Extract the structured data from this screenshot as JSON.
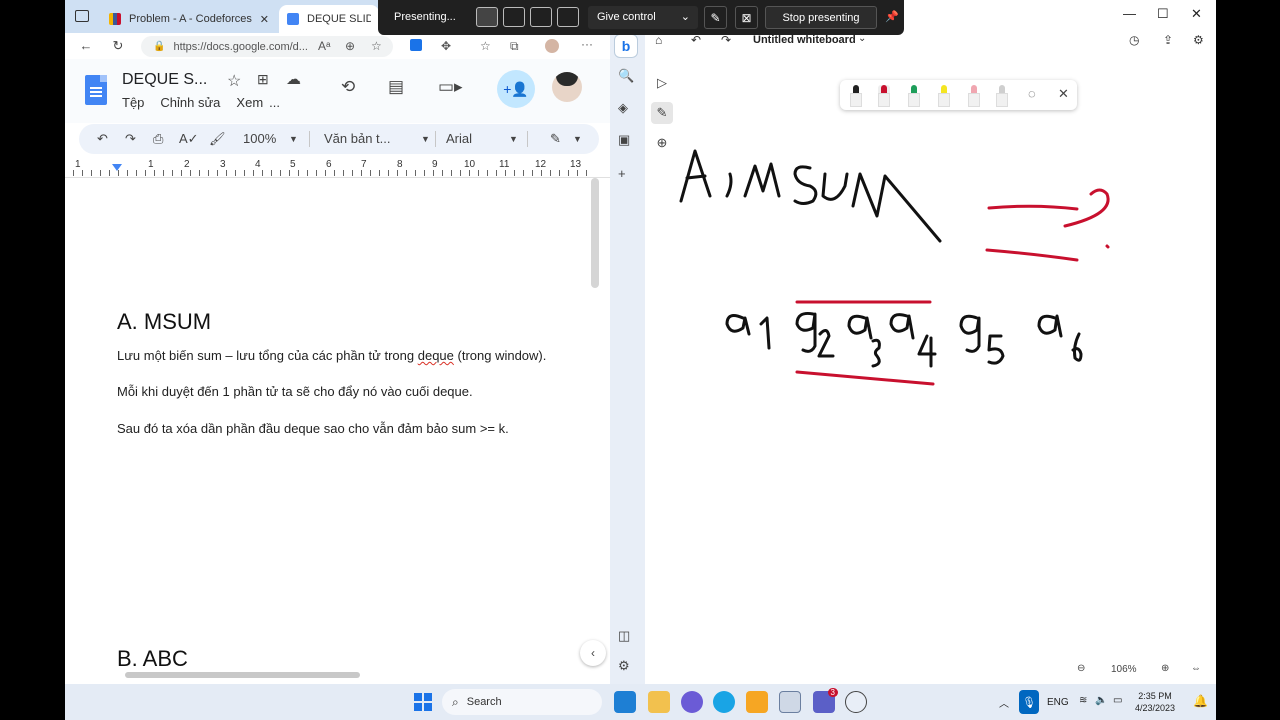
{
  "browser": {
    "tabs": [
      {
        "label": "Problem - A - Codeforces",
        "favicon_color": "#3b5998"
      },
      {
        "label": "DEQUE SLIDING W",
        "favicon_color": "#4285f4"
      }
    ],
    "url": "https://docs.google.com/d...",
    "icons": {
      "back": "←",
      "refresh": "↻",
      "read_aloud": "Aᵃ",
      "zoom": "⊕",
      "favorite": "☆",
      "extensions": "⧉",
      "menu": "···"
    }
  },
  "docs": {
    "title": "DEQUE S...",
    "menu": [
      "Tệp",
      "Chỉnh sửa",
      "Xem",
      "..."
    ],
    "toolbar": {
      "zoom": "100%",
      "style": "Văn bản t...",
      "font": "Arial"
    },
    "ruler_numbers": [
      "1",
      "1",
      "2",
      "3",
      "4",
      "5",
      "6",
      "7",
      "8",
      "9",
      "10",
      "11",
      "12",
      "13"
    ],
    "heading_a": "A. MSUM",
    "paragraphs": {
      "p1_before": "Lưu một biến sum – lưu tổng của các phần tử trong ",
      "p1_word": "deque",
      "p1_after": " (trong window).",
      "p2": "Mỗi khi duyệt đến 1 phần tử ta sẽ cho đẩy nó vào cuối deque.",
      "p3": "Sau đó ta xóa dần phần đầu deque sao cho vẫn đảm bảo sum >= k."
    },
    "heading_b": "B. ABC"
  },
  "whiteboard": {
    "title": "Untitled whiteboard",
    "zoom": "106%",
    "pen_colors": [
      "#222222",
      "#c8102e",
      "#1e9e5a",
      "#f4e522",
      "#f0a6b0",
      "#cfcfcf"
    ],
    "ink_colors": {
      "black": "#111111",
      "red": "#c8102e"
    }
  },
  "presenting": {
    "status": "Presenting...",
    "give_control": "Give control",
    "stop": "Stop presenting"
  },
  "taskbar": {
    "search": "Search",
    "lang": "ENG",
    "time": "2:35 PM",
    "date": "4/23/2023",
    "teams_badge": "3"
  }
}
